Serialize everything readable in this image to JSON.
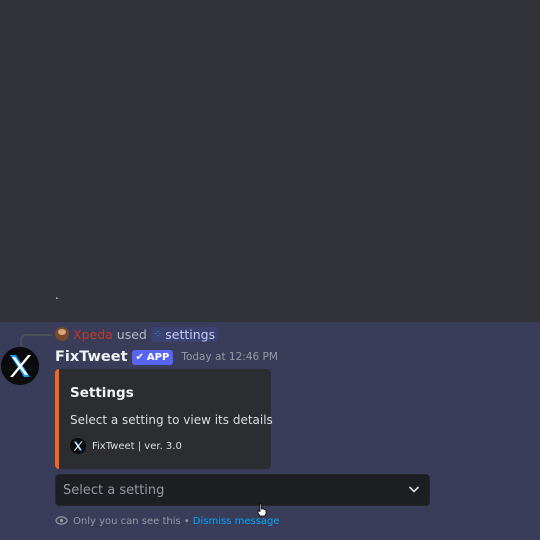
{
  "channel": {
    "prior_message_text": "."
  },
  "message": {
    "reply_context": {
      "user": "Xpeda",
      "used_text": "used",
      "command_icon": "slash-command-icon",
      "command": "settings"
    },
    "author": "FixTweet",
    "badge": "APP",
    "badge_icon": "check-icon",
    "timestamp": "Today at 12:46 PM",
    "embed": {
      "accent_color": "#f26522",
      "title": "Settings",
      "description": "Select a setting to view its details",
      "footer": "FixTweet | ver. 3.0"
    },
    "select_menu": {
      "placeholder": "Select a setting",
      "chevron_icon": "chevron-down-icon"
    },
    "ephemeral_note": {
      "icon": "eye-icon",
      "text": "Only you can see this •",
      "dismiss_label": "Dismiss message"
    }
  },
  "colors": {
    "background": "#313338",
    "highlight": "#3a3d5a",
    "blurple": "#5865f2",
    "link": "#00a8fc"
  }
}
